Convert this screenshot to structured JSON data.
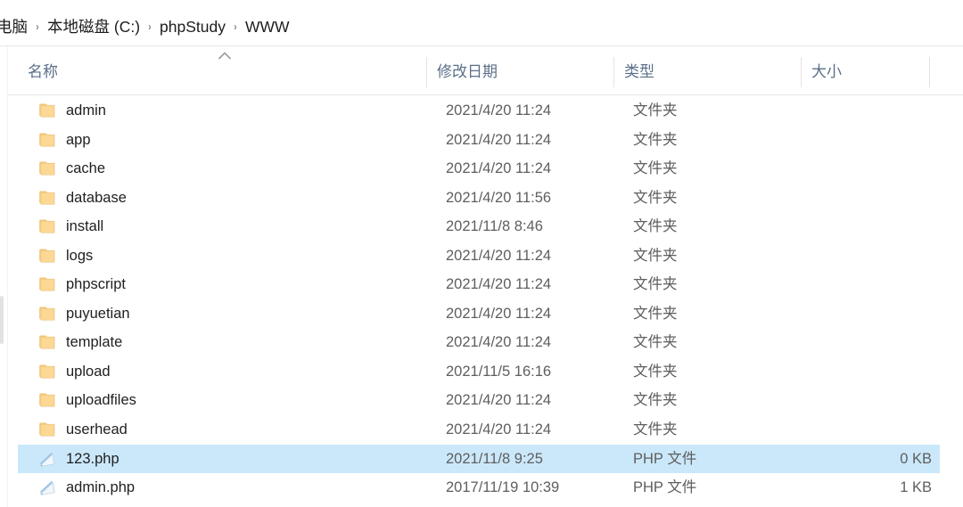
{
  "window": {
    "app": "file-explorer"
  },
  "breadcrumb": {
    "separator": "›",
    "items": [
      {
        "label": "电脑"
      },
      {
        "label": "本地磁盘 (C:)"
      },
      {
        "label": "phpStudy"
      },
      {
        "label": "WWW"
      }
    ]
  },
  "columns": {
    "name": "名称",
    "date": "修改日期",
    "type": "类型",
    "size": "大小",
    "sort_indicator": "ascending"
  },
  "colors": {
    "selection": "#cbe8fb",
    "header_text": "#5b6f88",
    "row_text": "#1f1f1f",
    "secondary_text": "#5e5e5e",
    "folder_icon": "#fcd690",
    "divider": "#e5e5e5"
  },
  "files": [
    {
      "name": "admin",
      "date": "2021/4/20 11:24",
      "type": "文件夹",
      "size": "",
      "icon": "folder-icon",
      "selected": false
    },
    {
      "name": "app",
      "date": "2021/4/20 11:24",
      "type": "文件夹",
      "size": "",
      "icon": "folder-icon",
      "selected": false
    },
    {
      "name": "cache",
      "date": "2021/4/20 11:24",
      "type": "文件夹",
      "size": "",
      "icon": "folder-icon",
      "selected": false
    },
    {
      "name": "database",
      "date": "2021/4/20 11:56",
      "type": "文件夹",
      "size": "",
      "icon": "folder-icon",
      "selected": false
    },
    {
      "name": "install",
      "date": "2021/11/8 8:46",
      "type": "文件夹",
      "size": "",
      "icon": "folder-icon",
      "selected": false
    },
    {
      "name": "logs",
      "date": "2021/4/20 11:24",
      "type": "文件夹",
      "size": "",
      "icon": "folder-icon",
      "selected": false
    },
    {
      "name": "phpscript",
      "date": "2021/4/20 11:24",
      "type": "文件夹",
      "size": "",
      "icon": "folder-icon",
      "selected": false
    },
    {
      "name": "puyuetian",
      "date": "2021/4/20 11:24",
      "type": "文件夹",
      "size": "",
      "icon": "folder-icon",
      "selected": false
    },
    {
      "name": "template",
      "date": "2021/4/20 11:24",
      "type": "文件夹",
      "size": "",
      "icon": "folder-icon",
      "selected": false
    },
    {
      "name": "upload",
      "date": "2021/11/5 16:16",
      "type": "文件夹",
      "size": "",
      "icon": "folder-icon",
      "selected": false
    },
    {
      "name": "uploadfiles",
      "date": "2021/4/20 11:24",
      "type": "文件夹",
      "size": "",
      "icon": "folder-icon",
      "selected": false
    },
    {
      "name": "userhead",
      "date": "2021/4/20 11:24",
      "type": "文件夹",
      "size": "",
      "icon": "folder-icon",
      "selected": false
    },
    {
      "name": "123.php",
      "date": "2021/11/8 9:25",
      "type": "PHP 文件",
      "size": "0 KB",
      "icon": "php-file-icon",
      "selected": true
    },
    {
      "name": "admin.php",
      "date": "2017/11/19 10:39",
      "type": "PHP 文件",
      "size": "1 KB",
      "icon": "php-file-icon",
      "selected": false
    }
  ]
}
